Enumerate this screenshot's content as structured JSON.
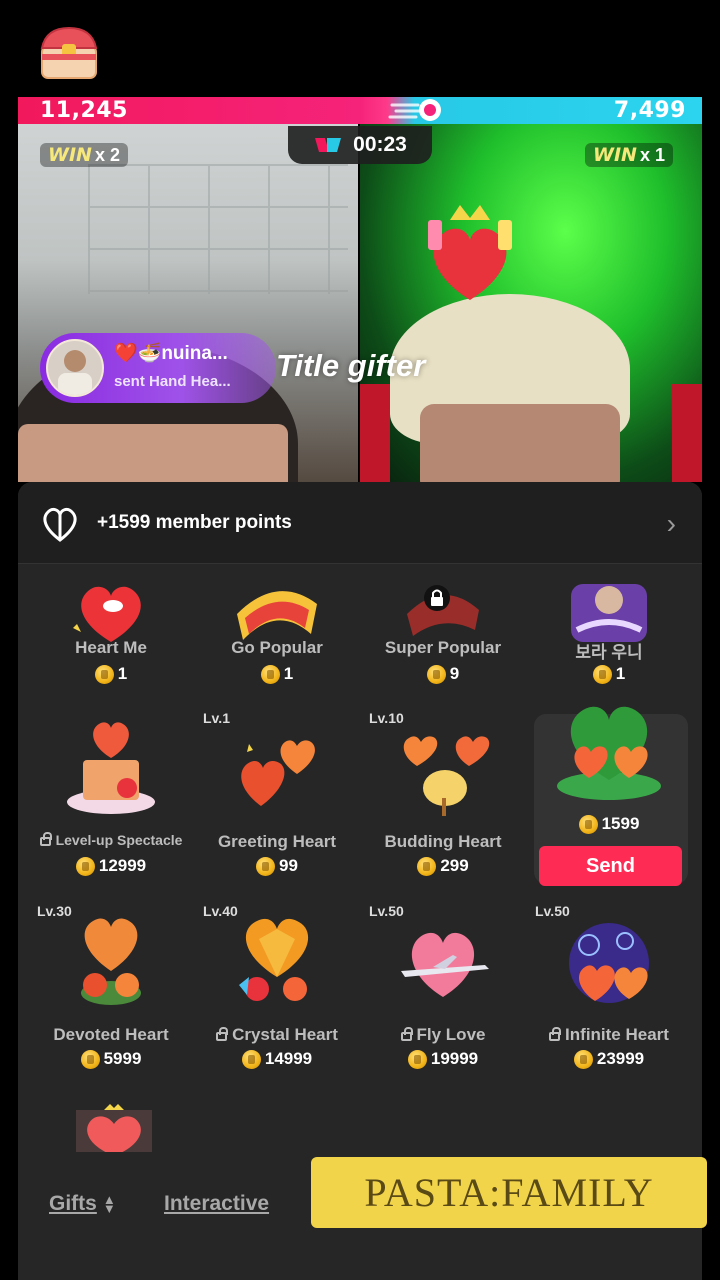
{
  "battle": {
    "left_score": "11,245",
    "right_score": "7,499",
    "timer": "00:23",
    "left_win": {
      "word": "WIN",
      "count": "x 2"
    },
    "right_win": {
      "word": "WIN",
      "count": "x 1"
    },
    "colors": {
      "left": "#f2185c",
      "right": "#27c9e6"
    }
  },
  "gift_alert": {
    "name": "❤️🍜nuina...",
    "message": "sent Hand Hea...",
    "title": "Title gifter"
  },
  "panel": {
    "points_text": "+1599 member points",
    "gifts": [
      {
        "name": "Heart Me",
        "price": "1"
      },
      {
        "name": "Go Popular",
        "price": "1"
      },
      {
        "name": "Super Popular",
        "price": "9"
      },
      {
        "name": "보라 우니",
        "price": "1"
      },
      {
        "name": "Level-up Spectacle",
        "price": "12999"
      },
      {
        "name": "Greeting Heart",
        "price": "99",
        "level": "Lv.1"
      },
      {
        "name": "Budding Heart",
        "price": "299",
        "level": "Lv.10"
      },
      {
        "name": "",
        "price": "1599",
        "selected": true
      },
      {
        "name": "Devoted Heart",
        "price": "5999",
        "level": "Lv.30"
      },
      {
        "name": "Crystal Heart",
        "price": "14999",
        "level": "Lv.40"
      },
      {
        "name": "Fly Love",
        "price": "19999",
        "level": "Lv.50"
      },
      {
        "name": "Infinite Heart",
        "price": "23999",
        "level": "Lv.50"
      }
    ],
    "send_label": "Send",
    "tabs": {
      "gifts": "Gifts",
      "interactive": "Interactive"
    }
  },
  "overlay": {
    "family": "PASTA:FAMILY"
  },
  "accent": "#fe2c55"
}
